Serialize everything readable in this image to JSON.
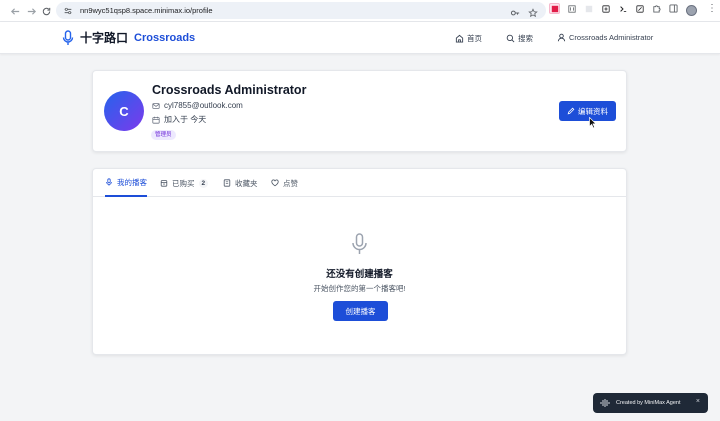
{
  "browser": {
    "url": "nn9wyc51qsp8.space.minimax.io/profile"
  },
  "header": {
    "logo_cn": "十字路口",
    "logo_en": "Crossroads",
    "nav": {
      "home": "首页",
      "search": "搜索",
      "user": "Crossroads Administrator"
    }
  },
  "profile": {
    "avatar_letter": "C",
    "name": "Crossroads Administrator",
    "email": "cyl7855@outlook.com",
    "joined": "加入于 今天",
    "role": "管理员",
    "edit_label": "编辑资料"
  },
  "tabs": [
    {
      "label": "我的播客",
      "icon": "mic-icon",
      "active": true
    },
    {
      "label": "已购买",
      "icon": "bag-icon",
      "count": "2"
    },
    {
      "label": "收藏夹",
      "icon": "bookmark-icon"
    },
    {
      "label": "点赞",
      "icon": "heart-icon"
    }
  ],
  "empty_state": {
    "title": "还没有创建播客",
    "subtitle": "开始创作您的第一个播客吧!",
    "button": "创建播客"
  },
  "toast": {
    "text": "Created by MiniMax Agent",
    "close": "×"
  },
  "colors": {
    "primary": "#1d4ed8",
    "badge_bg": "#ede9fe",
    "badge_text": "#6d28d9"
  }
}
